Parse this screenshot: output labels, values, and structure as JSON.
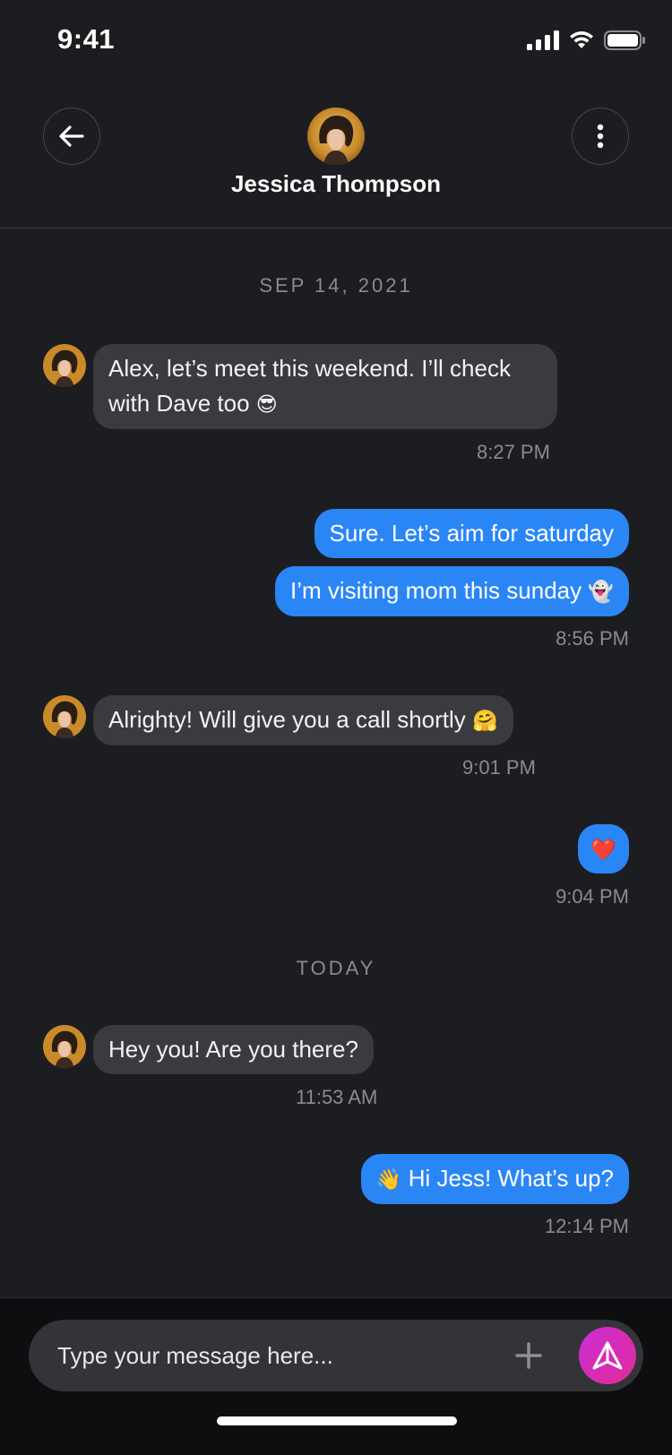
{
  "status_bar": {
    "time": "9:41"
  },
  "header": {
    "contact_name": "Jessica Thompson",
    "back_icon": "arrow-left-icon",
    "more_icon": "more-vertical-icon"
  },
  "conversation": {
    "date_1": "SEP 14, 2021",
    "date_2": "TODAY",
    "messages": [
      {
        "from": "contact",
        "text": "Alex, let’s meet this weekend. I’ll check",
        "text_line2": "with Dave too",
        "emoji": "😎",
        "time": "8:27 PM"
      },
      {
        "from": "me",
        "text": "Sure. Let’s aim for saturday"
      },
      {
        "from": "me",
        "text": "I’m visiting mom this sunday",
        "emoji": "👻",
        "time": "8:56 PM"
      },
      {
        "from": "contact",
        "text": "Alrighty! Will give you a call shortly",
        "emoji": "🤗",
        "time": "9:01 PM"
      },
      {
        "from": "me",
        "emoji": "❤️",
        "time": "9:04 PM"
      },
      {
        "from": "contact",
        "text": "Hey you! Are you there?",
        "time": "11:53 AM"
      },
      {
        "from": "me",
        "emoji": "👋",
        "text": "Hi Jess! What’s up?",
        "time": "12:14 PM"
      }
    ]
  },
  "composer": {
    "placeholder": "Type your message here...",
    "plus_icon": "plus-icon",
    "send_icon": "send-icon"
  },
  "colors": {
    "background": "#1c1d20",
    "incoming_bubble": "#3a3b3f",
    "outgoing_bubble": "#2b86f5",
    "send_button": "#d22bbb"
  }
}
